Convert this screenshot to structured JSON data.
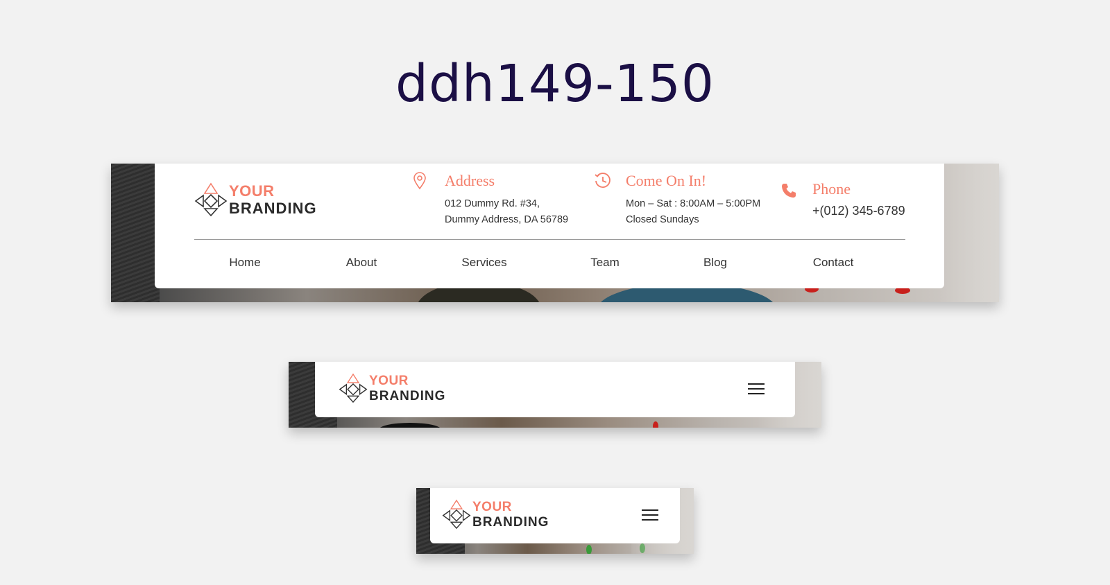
{
  "page_title": "ddh149-150",
  "colors": {
    "accent": "#f47e6a",
    "title": "#1b0f45",
    "text": "#333333"
  },
  "logo": {
    "line1": "YOUR",
    "line2": "BRANDING"
  },
  "desktop": {
    "address": {
      "icon": "map-pin-icon",
      "title": "Address",
      "line1": "012 Dummy Rd. #34,",
      "line2": "Dummy Address, DA 56789"
    },
    "hours": {
      "icon": "clock-icon",
      "title": "Come On In!",
      "line1": "Mon – Sat : 8:00AM – 5:00PM",
      "line2": "Closed Sundays"
    },
    "phone": {
      "icon": "phone-icon",
      "title": "Phone",
      "number": "+(012) 345-6789"
    },
    "nav": [
      "Home",
      "About",
      "Services",
      "Team",
      "Blog",
      "Contact"
    ]
  },
  "tablet": {
    "menu_icon": "hamburger-menu-icon"
  },
  "mobile": {
    "menu_icon": "hamburger-menu-icon"
  }
}
